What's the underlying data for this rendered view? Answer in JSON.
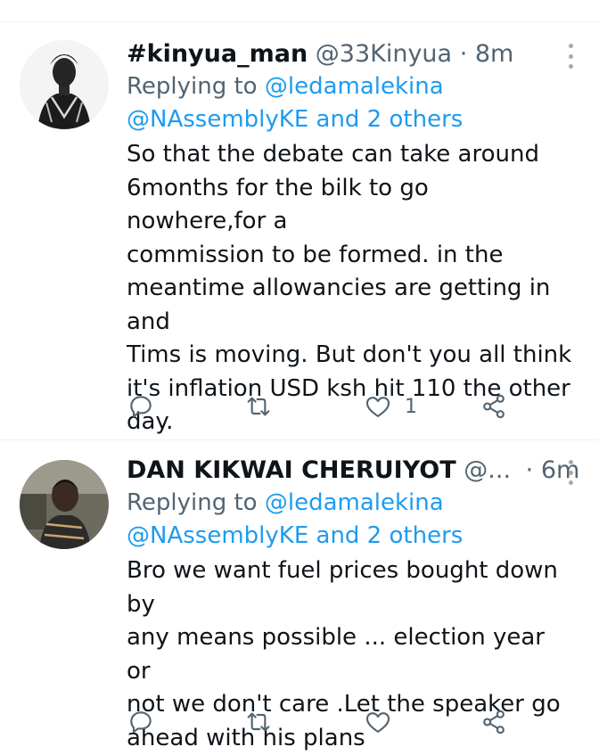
{
  "tweets": [
    {
      "name": "#kinyua_man",
      "handle": "@33Kinyua",
      "dot": "·",
      "time": "8m",
      "replying_prefix": "Replying to ",
      "replying_to": "@ledamalekina",
      "replying_more": "@NAssemblyKE and 2 others",
      "text_lines": [
        "So that the debate can take around",
        "6months for the bilk to go nowhere,for a",
        "commission to be formed. in the",
        "meantime allowancies are getting in and",
        "Tims is moving. But don't you all think",
        "it's inflation USD ksh hit 110 the other",
        "day."
      ],
      "likes": "1",
      "icons": [
        "reply-icon",
        "retweet-icon",
        "like-icon",
        "share-icon",
        "more-icon"
      ]
    },
    {
      "name": "DAN KIKWAI CHERUIYOT",
      "handle": "@...",
      "dot": "·",
      "time": "6m",
      "replying_prefix": "Replying to ",
      "replying_to": "@ledamalekina",
      "replying_more": "@NAssemblyKE and 2 others",
      "text_lines": [
        "Bro we want fuel prices bought down by",
        "any means possible ... election year or",
        "not we don't care .Let the speaker go",
        "ahead with his plans"
      ],
      "likes": "",
      "icons": [
        "reply-icon",
        "retweet-icon",
        "like-icon",
        "share-icon",
        "more-icon"
      ]
    }
  ],
  "colors": {
    "text": "#0f1419",
    "secondary": "#536471",
    "link": "#1d9bf0",
    "divider": "#eff3f4"
  }
}
